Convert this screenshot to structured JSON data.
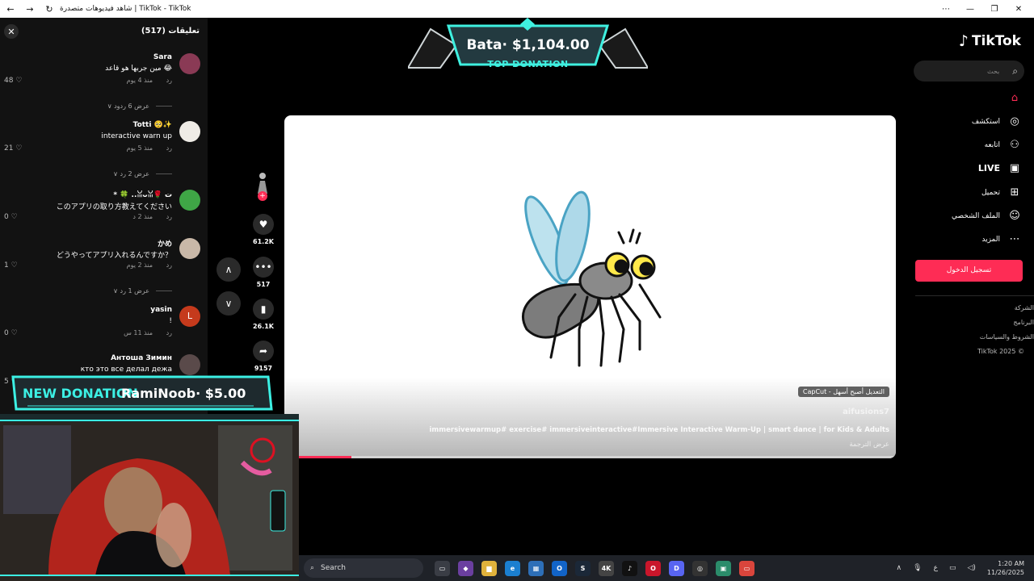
{
  "browser": {
    "window_title": "شاهد فيديوهات متصدرة | TikTok - TikTok",
    "nav_icons": [
      "back-icon",
      "forward-icon",
      "reload-icon"
    ],
    "window_controls": [
      "more-icon",
      "minimize-icon",
      "restore-icon",
      "close-icon"
    ]
  },
  "comments": {
    "title": "تعليقات (517)",
    "items": [
      {
        "user": "Sara",
        "text": "مين جربها هو قاعد 😂",
        "time": "منذ 4 يوم",
        "reply": "رد",
        "likes": "48",
        "avatar_color": "#8a3a55",
        "replies": "عرض 6 ردود"
      },
      {
        "user": "Totti 🥺✨",
        "text": "interactive warn up",
        "time": "منذ 5 يوم",
        "reply": "رد",
        "likes": "21",
        "avatar_color": "#efece6",
        "replies": "عرض 2 رد"
      },
      {
        "user": "* 🍀 ..ꈍᴗꈍ🌹 ت",
        "text": "このアプリの取り方教えてください",
        "time": "منذ 2 د",
        "reply": "رد",
        "likes": "0",
        "avatar_color": "#3fa646",
        "replies": ""
      },
      {
        "user": "かめ",
        "text": "どうやってアプリ入れるんですか？",
        "time": "منذ 2 يوم",
        "reply": "رد",
        "likes": "1",
        "avatar_color": "#c9b8a8",
        "replies": "عرض 1 رد"
      },
      {
        "user": "yasin",
        "text": "!",
        "time": "منذ 11 س",
        "reply": "رد",
        "likes": "0",
        "avatar_color": "#c53a1c",
        "avatar_letter": "L",
        "replies": ""
      },
      {
        "user": "Антоша Зимин",
        "text": "кто это все делал дежа",
        "time": "",
        "reply": "",
        "likes": "5",
        "avatar_color": "#5a4a4a",
        "replies": ""
      }
    ]
  },
  "actions": {
    "likes": "61.2K",
    "comments": "517",
    "saves": "26.1K",
    "shares": "9157"
  },
  "video": {
    "capcut_label": "CapCut - التعديل أصبح أسهل",
    "username": "aifusions7",
    "description": "immersivewarmup# exercise# immersiveinteractive#Immersive Interactive Warm-Up | smart dance | for Kids & Adults",
    "translate": "عرض الترجمة",
    "progress_percent": 11
  },
  "overlays": {
    "top_amount": "Bata· $1,104.00",
    "top_label": "TOP DONATION",
    "new_label": "NEW DONATION",
    "new_value": "RamiNoob· $5.00"
  },
  "sidebar": {
    "logo": "TikTok",
    "search_placeholder": "بحث",
    "menu": [
      {
        "label": "",
        "icon": "home-icon",
        "active": true
      },
      {
        "label": "استكشف",
        "icon": "compass-icon"
      },
      {
        "label": "اتابعه",
        "icon": "following-icon"
      },
      {
        "label": "LIVE",
        "icon": "live-icon"
      },
      {
        "label": "تحميل",
        "icon": "upload-icon"
      },
      {
        "label": "الملف الشخصي",
        "icon": "profile-icon"
      },
      {
        "label": "المزيد",
        "icon": "more-icon"
      }
    ],
    "login": "تسجيل الدخول",
    "footer": [
      "الشركة",
      "البرنامج",
      "الشروط والسياسات",
      "TikTok 2025 ©"
    ]
  },
  "taskbar": {
    "search_label": "Search",
    "time": "1:20 AM",
    "date": "11/26/2025",
    "lang": "ع",
    "icons": [
      {
        "name": "taskview-icon",
        "text": "▭",
        "bg": "#3a3d45"
      },
      {
        "name": "widgets-icon",
        "text": "◆",
        "bg": "#6b3fa0"
      },
      {
        "name": "file-explorer-icon",
        "text": "▆",
        "bg": "#e0b23c"
      },
      {
        "name": "edge-icon",
        "text": "e",
        "bg": "#1b7fd0"
      },
      {
        "name": "store-icon",
        "text": "▦",
        "bg": "#2d6fb8"
      },
      {
        "name": "outlook-icon",
        "text": "O",
        "bg": "#1264c8"
      },
      {
        "name": "steam-icon",
        "text": "S",
        "bg": "#1b2838"
      },
      {
        "name": "4k-icon",
        "text": "4K",
        "bg": "#444"
      },
      {
        "name": "tiktok-icon",
        "text": "♪",
        "bg": "#111"
      },
      {
        "name": "opera-icon",
        "text": "O",
        "bg": "#c9162b"
      },
      {
        "name": "discord-icon",
        "text": "D",
        "bg": "#5865f2"
      },
      {
        "name": "obs-icon",
        "text": "◎",
        "bg": "#333"
      },
      {
        "name": "app-icon",
        "text": "▣",
        "bg": "#2b8c6b"
      },
      {
        "name": "streamlabs-icon",
        "text": "▭",
        "bg": "#d9453c"
      }
    ]
  },
  "colors": {
    "accent": "#fe2c55",
    "donation_cyan": "#3ff0e0"
  }
}
